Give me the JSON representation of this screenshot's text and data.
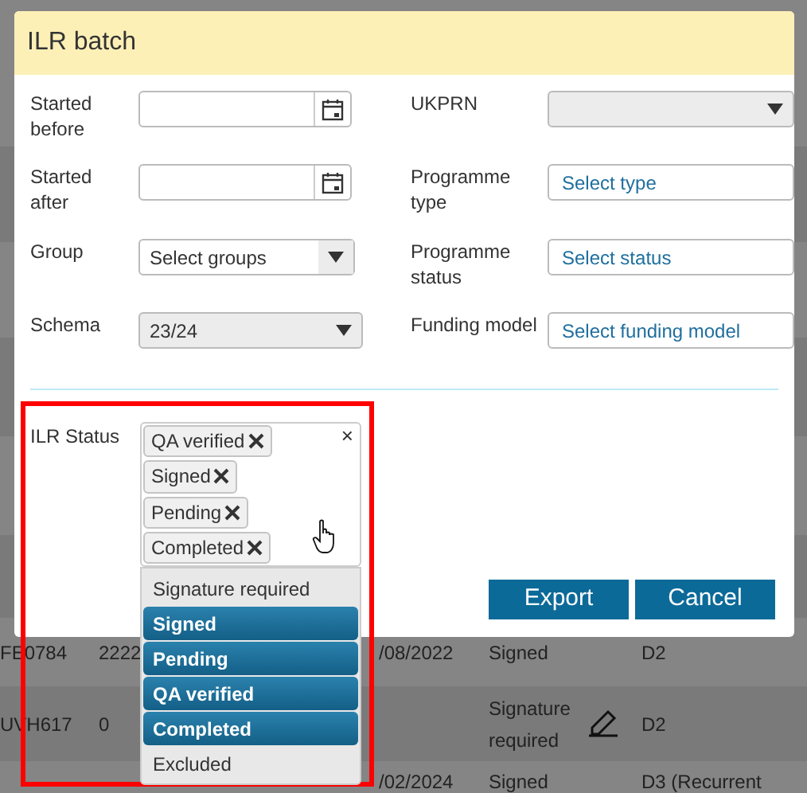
{
  "background_rows": [
    {
      "column_1": "FE0784",
      "column_2": "2222",
      "column_3": "/08/2022",
      "column_4": "Signed",
      "column_6": "D2"
    },
    {
      "column_1": "UVH617",
      "column_2": "0",
      "column_4": "Signature required",
      "sign_icon": true,
      "column_6": "D2"
    },
    {
      "column_3": "/02/2024",
      "column_4": "Signed",
      "column_6": "D3 (Recurrent"
    }
  ],
  "dialog": {
    "title": "ILR batch",
    "fields": [
      {
        "label": "Started before",
        "kind": "date"
      },
      {
        "label": "UKPRN",
        "kind": "select",
        "disabled": true
      },
      {
        "label": "Started after",
        "kind": "date"
      },
      {
        "label": "Programme type",
        "kind": "picker",
        "placeholder": "Select type"
      },
      {
        "label": "Group",
        "kind": "select",
        "value": "Select groups",
        "disabled": false
      },
      {
        "label": "Programme status",
        "kind": "picker",
        "placeholder": "Select status"
      },
      {
        "label": "Schema",
        "kind": "select",
        "value": "23/24",
        "disabled": true
      },
      {
        "label": "Funding model",
        "kind": "picker",
        "placeholder": "Select funding model"
      }
    ],
    "ilr_status": {
      "label": "ILR Status",
      "clear": "×",
      "tags": [
        "QA verified",
        "Signed",
        "Pending",
        "Completed"
      ],
      "options": [
        {
          "label": "Signature required",
          "selected": false
        },
        {
          "label": "Signed",
          "selected": true
        },
        {
          "label": "Pending",
          "selected": true
        },
        {
          "label": "QA verified",
          "selected": true
        },
        {
          "label": "Completed",
          "selected": true
        },
        {
          "label": "Excluded",
          "selected": false
        }
      ]
    },
    "buttons": [
      "Export",
      "Cancel"
    ]
  }
}
